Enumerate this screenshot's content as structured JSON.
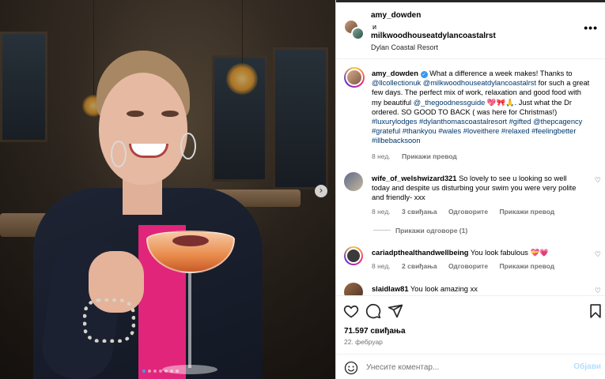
{
  "post": {
    "author": "amy_dowden",
    "and_word": "и",
    "coauthor": "milkwoodhouseatdylancoastalrst",
    "location": "Dylan Coastal Resort",
    "more_label": "•••"
  },
  "caption": {
    "user": "amy_dowden",
    "verified_glyph": "✓",
    "text1": " What a difference a week makes! Thanks to ",
    "mention1": "@llcollectionuk",
    "text2": " ",
    "mention2": "@milkwoodhouseatdylancoastalrst",
    "text3": " for such a great few days. The perfect mix of work, relaxation and good food with my beautiful ",
    "mention3": "@_thegoodnessguide",
    "text4": " 💖🎀🙏. Just what the Dr ordered. SO GOOD TO BACK ( was here for Christmas!) ",
    "tags": "#luxurylodges #dylanthomascoastalresort #gifted @thepcagency #grateful #thankyou #wales #loveithere #relaxed #feelingbetter #illbebacksoon",
    "time": "8 нед.",
    "translate": "Прикажи превод"
  },
  "comments": [
    {
      "user": "wife_of_welshwizard321",
      "text": " So lovely to see u looking so well today and despite us disturbing your swim you were very polite and friendly- xxx",
      "time": "8 нед.",
      "likes": "3 свиђања",
      "reply": "Одговорите",
      "translate": "Прикажи превод"
    },
    {
      "user": "cariadpthealthandwellbeing",
      "text": " You look fabulous 💝💗",
      "time": "8 нед.",
      "likes": "2 свиђања",
      "reply": "Одговорите",
      "translate": "Прикажи превод"
    },
    {
      "user": "slaidlaw81",
      "text": " You look amazing xx"
    }
  ],
  "view_replies": "Прикажи одговоре (1)",
  "engagement": {
    "likes": "71.597 свиђања",
    "date": "22. фебруар"
  },
  "add_comment": {
    "placeholder": "Унесите коментар...",
    "post_label": "Објави"
  },
  "carousel": {
    "next_glyph": "›",
    "slide_count": 7,
    "active_index": 0
  },
  "colors": {
    "link": "#00376b",
    "muted": "#737373",
    "verified": "#3897f0",
    "post_disabled": "#b2dffc",
    "active_dot": "#3e9bff"
  },
  "icons": [
    "heart-icon",
    "comment-icon",
    "share-icon",
    "bookmark-icon",
    "emoji-icon",
    "more-icon",
    "chevron-right-icon"
  ]
}
